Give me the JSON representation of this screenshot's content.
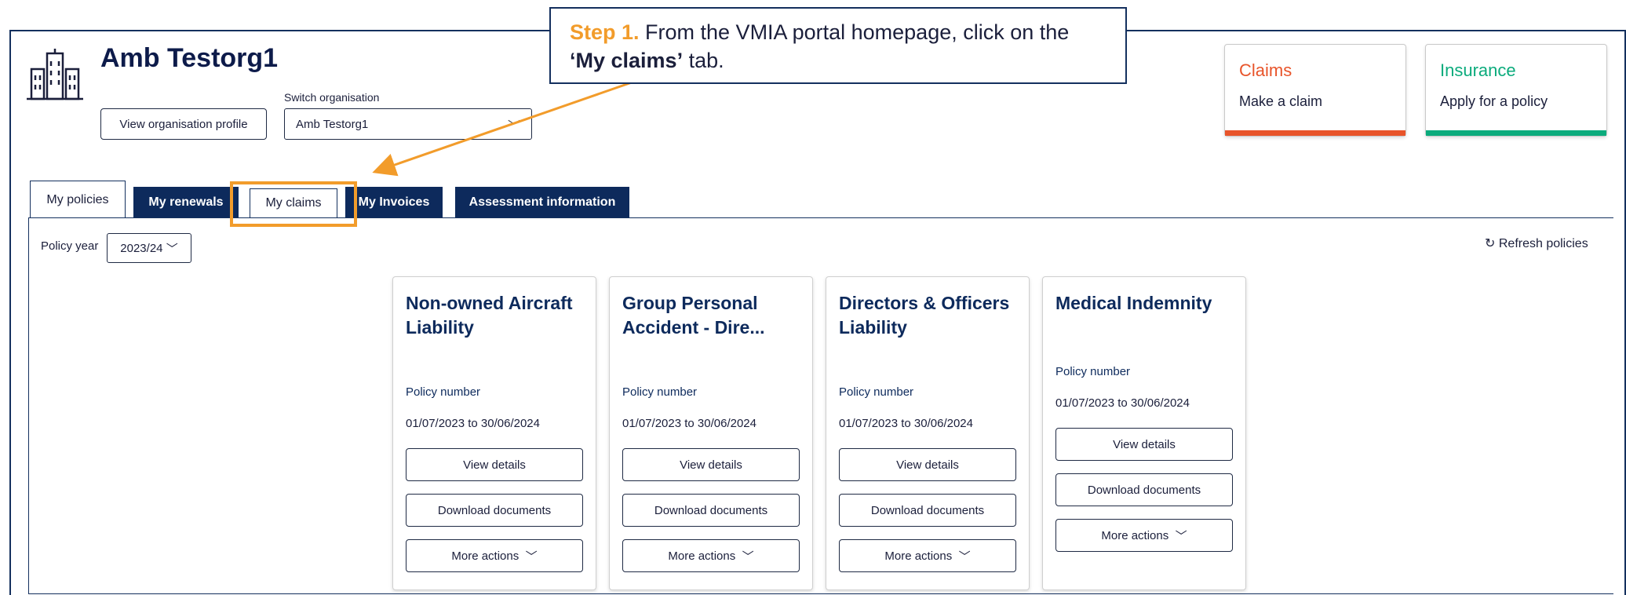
{
  "organisation": {
    "name": "Amb Testorg1",
    "view_profile_label": "View organisation profile",
    "switch_label": "Switch organisation",
    "switch_value": "Amb Testorg1"
  },
  "quick_actions": [
    {
      "title": "Claims",
      "link": "Make a claim",
      "color": "#e8542a"
    },
    {
      "title": "Insurance",
      "link": "Apply for a policy",
      "color": "#0bab7c"
    }
  ],
  "callout": {
    "step": "Step 1.",
    "text_before": " From the VMIA portal homepage, click on the ",
    "emphasis": "‘My claims’",
    "text_after": " tab."
  },
  "tabs": [
    "My policies",
    "My renewals",
    "My claims",
    "My Invoices",
    "Assessment information"
  ],
  "policy_year": {
    "label": "Policy year",
    "value": "2023/24"
  },
  "refresh_label": "Refresh policies",
  "policies": [
    {
      "title": "Non-owned Aircraft Liability",
      "number_label": "Policy number",
      "dates": "01/07/2023  to  30/06/2024",
      "view": "View details",
      "download": "Download documents",
      "more": "More actions"
    },
    {
      "title": "Group Personal Accident - Dire...",
      "number_label": "Policy number",
      "dates": "01/07/2023  to  30/06/2024",
      "view": "View details",
      "download": "Download documents",
      "more": "More actions"
    },
    {
      "title": "Directors & Officers Liability",
      "number_label": "Policy number",
      "dates": "01/07/2023  to  30/06/2024",
      "view": "View details",
      "download": "Download documents",
      "more": "More actions"
    },
    {
      "title": "Medical Indemnity",
      "number_label": "Policy number",
      "dates": "01/07/2023  to  30/06/2024",
      "view": "View details",
      "download": "Download documents",
      "more": "More actions"
    }
  ],
  "colors": {
    "brand_navy": "#0d2a5c",
    "highlight_orange": "#f29c2b"
  }
}
